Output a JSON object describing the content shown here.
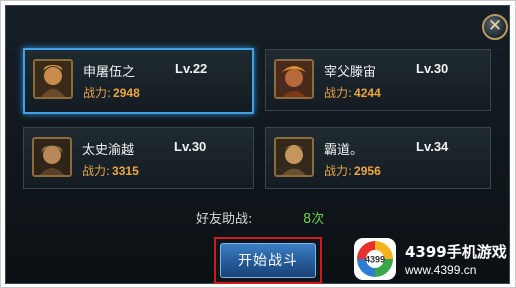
{
  "close_symbol": "✕",
  "heroes": [
    {
      "name": "申屠伍之",
      "level": "Lv.22",
      "power_label": "战力:",
      "power": "2948",
      "selected": true
    },
    {
      "name": "宰父滕宙",
      "level": "Lv.30",
      "power_label": "战力:",
      "power": "4244",
      "selected": false
    },
    {
      "name": "太史渝越",
      "level": "Lv.30",
      "power_label": "战力:",
      "power": "3315",
      "selected": false
    },
    {
      "name": "霸道。",
      "level": "Lv.34",
      "power_label": "战力:",
      "power": "2956",
      "selected": false
    }
  ],
  "assist": {
    "label": "好友助战:",
    "count": "8次"
  },
  "start_button": "开始战斗",
  "watermark": {
    "logo_text": "4399",
    "name": "4399手机游戏",
    "url": "www.4399.cn"
  },
  "colors": {
    "selected_border": "#3fa2e6",
    "power": "#f0a640",
    "count": "#6ccf4a",
    "highlight": "#d11a1a"
  }
}
